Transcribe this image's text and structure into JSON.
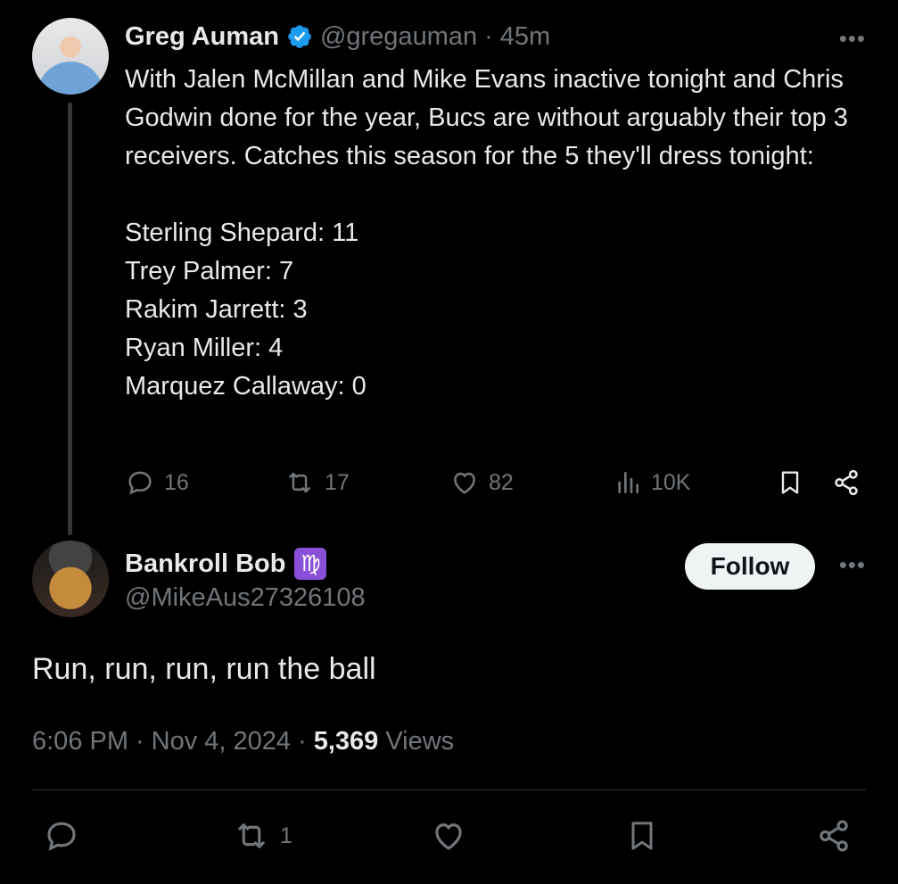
{
  "parent": {
    "name": "Greg Auman",
    "handle": "@gregauman",
    "separator": "·",
    "time": "45m",
    "text": "With Jalen McMillan and Mike Evans inactive tonight and Chris Godwin done for the year, Bucs are without arguably their top 3 receivers. Catches this season for the 5 they'll dress tonight:\n\nSterling Shepard: 11\nTrey Palmer: 7\nRakim Jarrett: 3\nRyan Miller: 4\nMarquez Callaway: 0",
    "stats": {
      "replies": "16",
      "reposts": "17",
      "likes": "82",
      "views": "10K"
    },
    "more_label": "•••"
  },
  "reply": {
    "name": "Bankroll Bob",
    "badge": "♍",
    "handle": "@MikeAus27326108",
    "follow_label": "Follow",
    "more_label": "•••",
    "text": "Run, run, run, run the ball",
    "time": "6:06 PM",
    "separator": "·",
    "date": "Nov 4, 2024",
    "views_count": "5,369",
    "views_label": "Views",
    "reposts": "1"
  },
  "colors": {
    "background": "#000000",
    "text": "#e7e9ea",
    "muted": "#71767b",
    "verified": "#1d9bf0",
    "divider": "#2f3336"
  },
  "icons": [
    "verified-badge-icon",
    "reply-icon",
    "repost-icon",
    "like-icon",
    "views-icon",
    "bookmark-icon",
    "share-icon",
    "more-icon"
  ]
}
